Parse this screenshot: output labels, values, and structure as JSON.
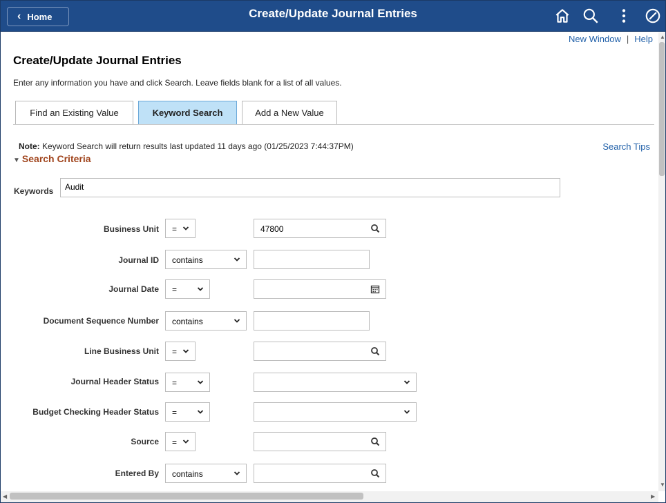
{
  "header": {
    "home_label": "Home",
    "title": "Create/Update Journal Entries"
  },
  "top_links": {
    "new_window": "New Window",
    "separator": "|",
    "help": "Help"
  },
  "page": {
    "title": "Create/Update Journal Entries",
    "instructions": "Enter any information you have and click Search. Leave fields blank for a list of all values."
  },
  "tabs": [
    {
      "label": "Find an Existing Value",
      "active": false
    },
    {
      "label": "Keyword Search",
      "active": true
    },
    {
      "label": "Add a New Value",
      "active": false
    }
  ],
  "note": {
    "prefix": "Note:",
    "text": " Keyword Search will return results last updated 11 days ago (01/25/2023 7:44:37PM)"
  },
  "search_tips": "Search Tips",
  "search_criteria": "Search Criteria",
  "keywords": {
    "label": "Keywords",
    "value": "Audit"
  },
  "fields": [
    {
      "label": "Business Unit",
      "operator": "=",
      "value": "47800",
      "value_icon": "search-icon"
    },
    {
      "label": "Journal ID",
      "operator": "contains",
      "value": ""
    },
    {
      "label": "Journal Date",
      "operator": "=",
      "value": "",
      "value_icon": "calendar-icon"
    },
    {
      "label": "Document Sequence Number",
      "operator": "contains",
      "value": ""
    },
    {
      "label": "Line Business Unit",
      "operator": "=",
      "value": "",
      "value_icon": "search-icon"
    },
    {
      "label": "Journal Header Status",
      "operator": "=",
      "value": "",
      "value_type": "dropdown"
    },
    {
      "label": "Budget Checking Header Status",
      "operator": "=",
      "value": "",
      "value_type": "dropdown"
    },
    {
      "label": "Source",
      "operator": "=",
      "value": "",
      "value_icon": "search-icon"
    },
    {
      "label": "Entered By",
      "operator": "contains",
      "value": "",
      "value_icon": "search-icon"
    }
  ],
  "colors": {
    "header_bg": "#1f4c8a",
    "active_tab": "#bfe1f7",
    "link": "#1f5fa8",
    "criteria": "#a0441c"
  }
}
